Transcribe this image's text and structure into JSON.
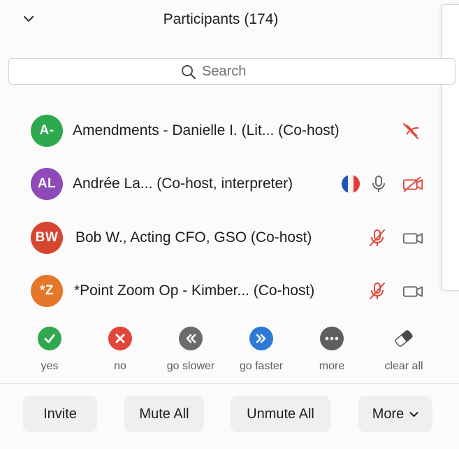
{
  "header": {
    "title": "Participants",
    "count": "(174)"
  },
  "search": {
    "placeholder": "Search",
    "value": ""
  },
  "participants": [
    {
      "initials": "A-",
      "name": "Amendments -  Danielle I. (Lit... (Co-host)",
      "avatar_color": "#2fa84f",
      "mic": "none",
      "video": "video-off-icon"
    },
    {
      "initials": "AL",
      "name": "Andrée La... (Co-host, interpreter)",
      "avatar_color": "#8e4bb8",
      "flag": "french-flag-icon",
      "mic": "microphone-icon",
      "video": "video-off-icon"
    },
    {
      "initials": "BW",
      "name": "Bob W., Acting CFO, GSO (Co-host)",
      "avatar_color": "#d6452e",
      "mic": "microphone-muted-icon",
      "video": "video-camera-icon"
    },
    {
      "initials": "*Z",
      "name": "*Point Zoom Op - Kimber... (Co-host)",
      "avatar_color": "#e5762a",
      "mic": "microphone-muted-icon",
      "video": "video-camera-icon"
    }
  ],
  "reactions": [
    {
      "label": "yes",
      "icon": "checkmark-icon",
      "color": "#2fa84f"
    },
    {
      "label": "no",
      "icon": "x-icon",
      "color": "#e0463a"
    },
    {
      "label": "go slower",
      "icon": "rewind-icon",
      "color": "#6b6b6b"
    },
    {
      "label": "go faster",
      "icon": "fast-forward-icon",
      "color": "#2d7ad6"
    },
    {
      "label": "more",
      "icon": "ellipsis-icon",
      "color": "#5e5e5e"
    },
    {
      "label": "clear all",
      "icon": "eraser-icon",
      "color": "#444444"
    }
  ],
  "footer": {
    "invite": "Invite",
    "mute_all": "Mute All",
    "unmute_all": "Unmute All",
    "more": "More"
  },
  "colors": {
    "muted_red": "#e0463a",
    "icon_gray": "#6b6b6b"
  }
}
